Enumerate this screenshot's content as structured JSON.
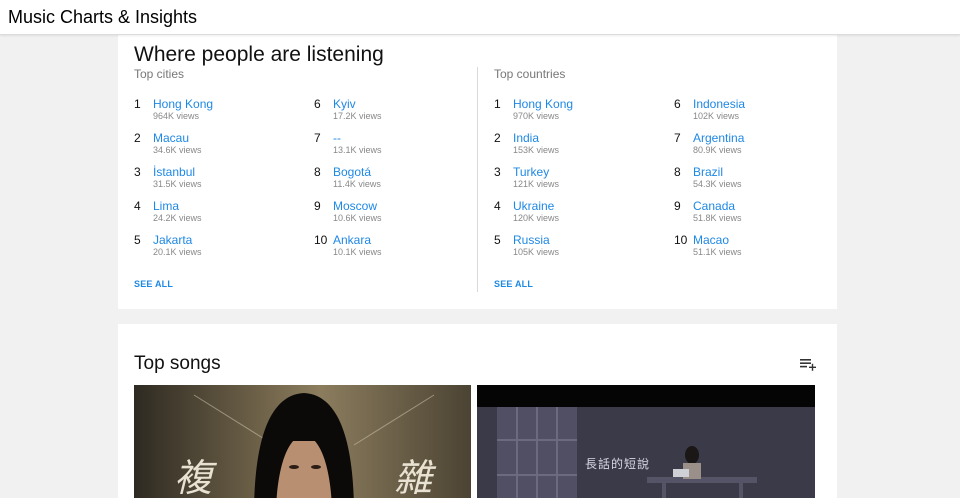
{
  "app": {
    "title": "Music Charts & Insights"
  },
  "listening": {
    "title": "Where people are listening",
    "cities": {
      "heading": "Top cities",
      "items": [
        {
          "rank": "1",
          "name": "Hong Kong",
          "views": "964K views"
        },
        {
          "rank": "2",
          "name": "Macau",
          "views": "34.6K views"
        },
        {
          "rank": "3",
          "name": "İstanbul",
          "views": "31.5K views"
        },
        {
          "rank": "4",
          "name": "Lima",
          "views": "24.2K views"
        },
        {
          "rank": "5",
          "name": "Jakarta",
          "views": "20.1K views"
        },
        {
          "rank": "6",
          "name": "Kyiv",
          "views": "17.2K views"
        },
        {
          "rank": "7",
          "name": "--",
          "views": "13.1K views"
        },
        {
          "rank": "8",
          "name": "Bogotá",
          "views": "11.4K views"
        },
        {
          "rank": "9",
          "name": "Moscow",
          "views": "10.6K views"
        },
        {
          "rank": "10",
          "name": "Ankara",
          "views": "10.1K views"
        }
      ],
      "see_all": "SEE ALL"
    },
    "countries": {
      "heading": "Top countries",
      "items": [
        {
          "rank": "1",
          "name": "Hong Kong",
          "views": "970K views"
        },
        {
          "rank": "2",
          "name": "India",
          "views": "153K views"
        },
        {
          "rank": "3",
          "name": "Turkey",
          "views": "121K views"
        },
        {
          "rank": "4",
          "name": "Ukraine",
          "views": "120K views"
        },
        {
          "rank": "5",
          "name": "Russia",
          "views": "105K views"
        },
        {
          "rank": "6",
          "name": "Indonesia",
          "views": "102K views"
        },
        {
          "rank": "7",
          "name": "Argentina",
          "views": "80.9K views"
        },
        {
          "rank": "8",
          "name": "Brazil",
          "views": "54.3K views"
        },
        {
          "rank": "9",
          "name": "Canada",
          "views": "51.8K views"
        },
        {
          "rank": "10",
          "name": "Macao",
          "views": "51.1K views"
        }
      ],
      "see_all": "SEE ALL"
    }
  },
  "songs": {
    "title": "Top songs",
    "icon": "playlist-add-icon",
    "thumbnails": [
      {
        "caption_left": "複",
        "caption_right": "雜"
      },
      {
        "caption": "長話的短說"
      }
    ]
  }
}
